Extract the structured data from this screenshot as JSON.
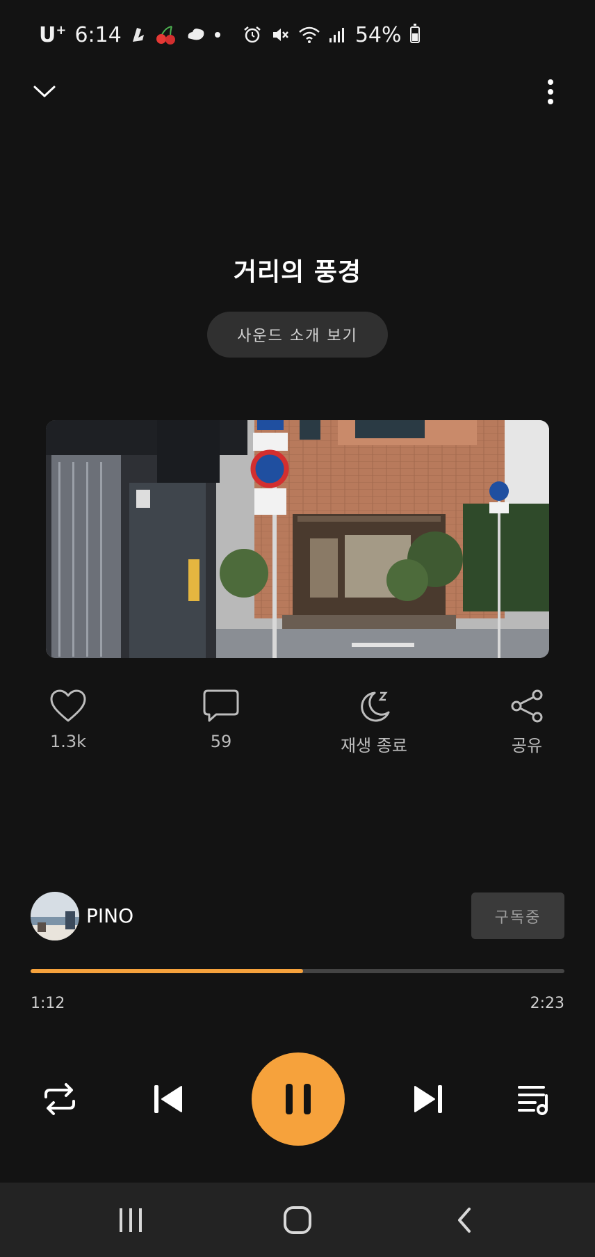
{
  "status_bar": {
    "carrier": "U",
    "carrier_plus": "+",
    "time": "6:14",
    "battery": "54%",
    "icons": [
      "notification-app-icon",
      "cherry-icon",
      "cloud-icon",
      "dot-icon",
      "alarm-icon",
      "mute-icon",
      "wifi-icon",
      "signal-icon",
      "battery-icon"
    ]
  },
  "header": {
    "collapse_icon": "chevron-down-icon",
    "menu_icon": "more-vertical-icon"
  },
  "track": {
    "title": "거리의 풍경",
    "info_button": "사운드 소개 보기"
  },
  "actions": [
    {
      "icon": "heart-icon",
      "label": "1.3k"
    },
    {
      "icon": "comment-icon",
      "label": "59"
    },
    {
      "icon": "sleep-timer-icon",
      "label": "재생 종료"
    },
    {
      "icon": "share-icon",
      "label": "공유"
    }
  ],
  "channel": {
    "name": "PINO",
    "subscribe_label": "구독중"
  },
  "progress": {
    "elapsed": "1:12",
    "total": "2:23",
    "fraction": 0.51
  },
  "controls": {
    "icons": [
      "repeat-icon",
      "previous-icon",
      "pause-icon",
      "next-icon",
      "playlist-icon"
    ]
  },
  "colors": {
    "accent": "#f6a23c",
    "background": "#131313",
    "button_bg": "#303030"
  },
  "nav_bar": {
    "icons": [
      "recent-apps-icon",
      "home-icon",
      "back-icon"
    ]
  }
}
